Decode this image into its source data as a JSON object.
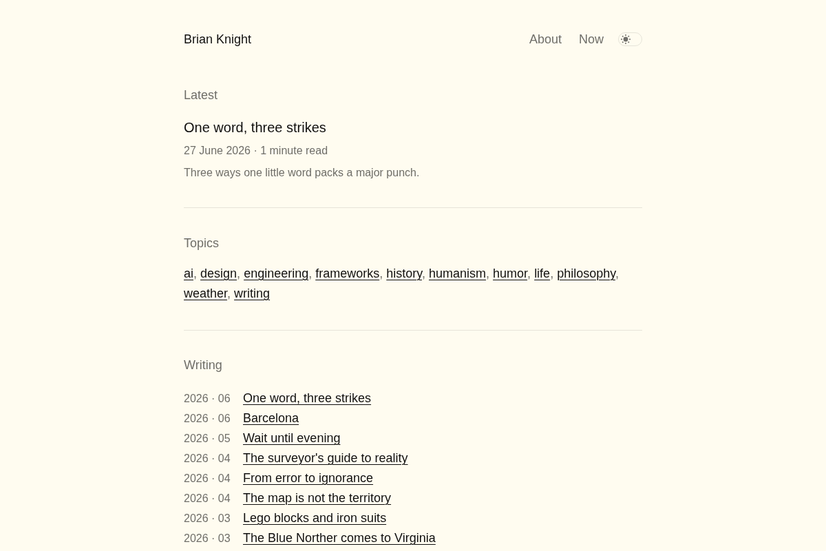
{
  "header": {
    "site_title": "Brian Knight",
    "nav": [
      "About",
      "Now"
    ],
    "theme_toggle": {
      "dark": false
    }
  },
  "latest": {
    "heading": "Latest",
    "title": "One word, three strikes",
    "meta": "27 June 2026 · 1 minute read",
    "summary": "Three ways one little word packs a major punch."
  },
  "topics": {
    "heading": "Topics",
    "separator": ",",
    "items": [
      "ai",
      "design",
      "engineering",
      "frameworks",
      "history",
      "humanism",
      "humor",
      "life",
      "philosophy",
      "weather",
      "writing"
    ]
  },
  "writing": {
    "heading": "Writing",
    "posts": [
      {
        "date": "2026 · 06",
        "title": "One word, three strikes"
      },
      {
        "date": "2026 · 06",
        "title": "Barcelona"
      },
      {
        "date": "2026 · 05",
        "title": "Wait until evening"
      },
      {
        "date": "2026 · 04",
        "title": "The surveyor's guide to reality"
      },
      {
        "date": "2026 · 04",
        "title": "From error to ignorance"
      },
      {
        "date": "2026 · 04",
        "title": "The map is not the territory"
      },
      {
        "date": "2026 · 03",
        "title": "Lego blocks and iron suits"
      },
      {
        "date": "2026 · 03",
        "title": "The Blue Norther comes to Virginia"
      }
    ]
  }
}
